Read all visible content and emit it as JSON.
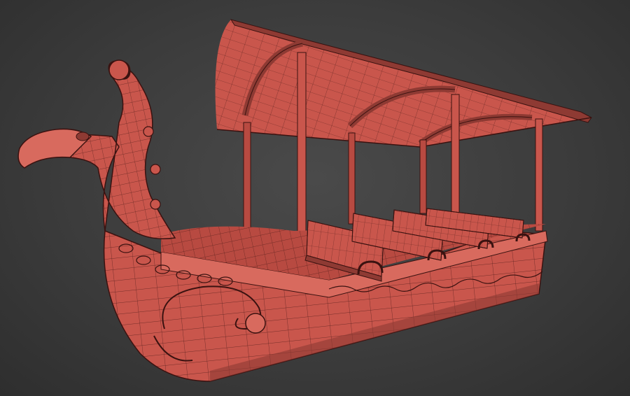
{
  "scene": {
    "subject": "boat-3d-wireframe",
    "colors": {
      "background": "#3c3c3c",
      "surface": "#c9564c",
      "surface_light": "#d86a5e",
      "surface_dark": "#8e3a33",
      "wire": "#3a1210",
      "interior": "#b84a41"
    }
  }
}
